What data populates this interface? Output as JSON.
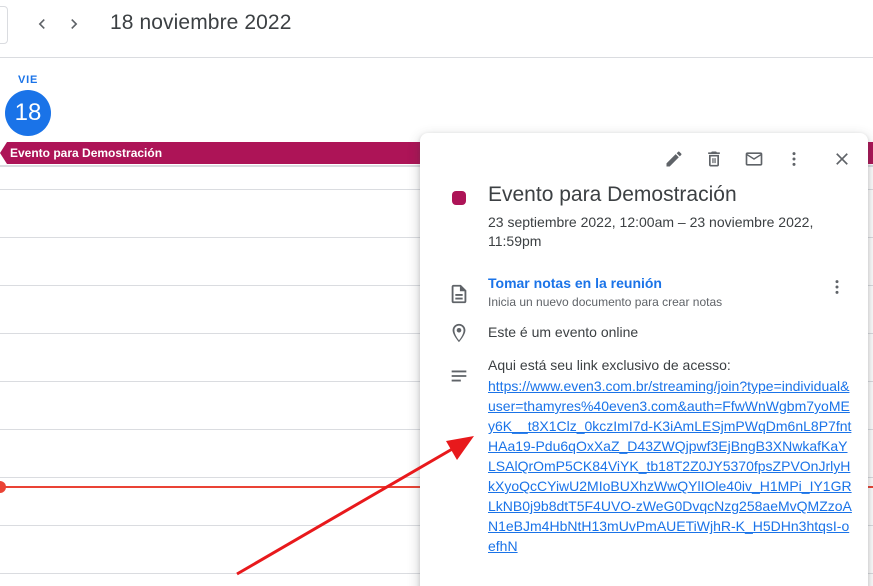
{
  "header": {
    "prev_icon": "chevron-left-icon",
    "next_icon": "chevron-right-icon",
    "date_title": "18 noviembre 2022"
  },
  "day": {
    "name": "VIE",
    "number": "18"
  },
  "allday_event": {
    "label": "Evento para Demostración",
    "color": "#ad1457"
  },
  "popover": {
    "toolbar": {
      "edit_icon": "pencil-icon",
      "delete_icon": "trash-icon",
      "email_icon": "mail-icon",
      "more_icon": "more-vert-icon",
      "close_icon": "close-icon"
    },
    "title": "Evento para Demostración",
    "color": "#ad1457",
    "when": "23 septiembre 2022, 12:00am – 23 noviembre 2022, 11:59pm",
    "notes": {
      "link": "Tomar notas en la reunión",
      "subtitle": "Inicia un nuevo documento para crear notas"
    },
    "location": "Este é um evento online",
    "description": {
      "intro": "Aqui está seu link exclusivo de acesso:",
      "link": "https://www.even3.com.br/streaming/join?type=individual&user=thamyres%40even3.com&auth=FfwWnWgbm7yoMEy6K__t8X1Clz_0kczImI7d-K3iAmLESjmPWqDm6nL8P7fntHAa19-Pdu6qOxXaZ_D43ZWQjpwf3EjBngB3XNwkafKaYLSAlQrOmP5CK84ViYK_tb18T2Z0JY5370fpsZPVOnJrlyHkXyoQcCYiwU2MIoBUXhzWwQYlIOle40iv_H1MPi_IY1GRLkNB0j9b8dtT5F4UVO-zWeG0DvqcNzg258aeMvQMZzoAN1eBJm4HbNtH13mUvPmAUETiWjhR-K_H5DHn3htqsI-oefhN"
    }
  },
  "colors": {
    "accent": "#1a73e8",
    "event": "#ad1457",
    "now_indicator": "#ea4335",
    "annotation": "#e8191c"
  }
}
